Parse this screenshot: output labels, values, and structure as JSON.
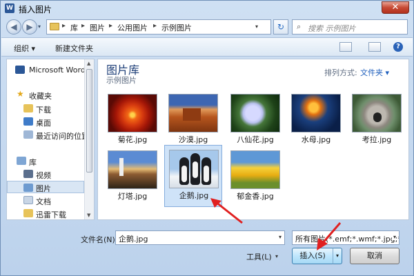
{
  "window": {
    "title": "插入图片",
    "close_label": "✕"
  },
  "address": {
    "crumbs": [
      "库",
      "图片",
      "公用图片",
      "示例图片"
    ],
    "separator": "▸",
    "refresh_glyph": "↻",
    "back_glyph": "◀",
    "forward_glyph": "▶",
    "search_placeholder": "搜索 示例图片",
    "search_glyph": "⌕"
  },
  "toolbar": {
    "organize": "组织 ▾",
    "new_folder": "新建文件夹",
    "help": "?"
  },
  "nav": {
    "items": [
      {
        "label": "Microsoft Word",
        "icon": "word-icon"
      },
      {
        "label": "收藏夹",
        "icon": "star-icon"
      },
      {
        "label": "下载",
        "icon": "download-folder-icon"
      },
      {
        "label": "桌面",
        "icon": "desktop-icon"
      },
      {
        "label": "最近访问的位置",
        "icon": "recent-places-icon"
      },
      {
        "label": "库",
        "icon": "library-icon"
      },
      {
        "label": "视频",
        "icon": "videos-icon"
      },
      {
        "label": "图片",
        "icon": "pictures-icon"
      },
      {
        "label": "文档",
        "icon": "documents-icon"
      },
      {
        "label": "迅雷下载",
        "icon": "thunder-download-icon"
      }
    ],
    "selected": "图片"
  },
  "content": {
    "library_title": "图片库",
    "library_subtitle": "示例图片",
    "arrange_label": "排列方式:",
    "arrange_value": "文件夹 ▾",
    "files": [
      {
        "name": "菊花.jpg",
        "image": "chrysanthemum"
      },
      {
        "name": "沙漠.jpg",
        "image": "desert"
      },
      {
        "name": "八仙花.jpg",
        "image": "hydrangea"
      },
      {
        "name": "水母.jpg",
        "image": "jellyfish"
      },
      {
        "name": "考拉.jpg",
        "image": "koala"
      },
      {
        "name": "灯塔.jpg",
        "image": "lighthouse"
      },
      {
        "name": "企鹅.jpg",
        "image": "penguins"
      },
      {
        "name": "郁金香.jpg",
        "image": "tulips"
      }
    ],
    "selected_file": "企鹅.jpg"
  },
  "bottom": {
    "filename_label": "文件名(N):",
    "filename_value": "企鹅.jpg",
    "filter_value": "所有图片(*.emf;*.wmf;*.jpg;*.jp",
    "tools_label": "工具(L)",
    "insert_label": "插入(S)",
    "cancel_label": "取消",
    "dropdown_glyph": "▾"
  },
  "colors": {
    "accent_blue": "#1f5fbd",
    "annotation_red": "#e02020",
    "selection": "#cfe3f8"
  }
}
